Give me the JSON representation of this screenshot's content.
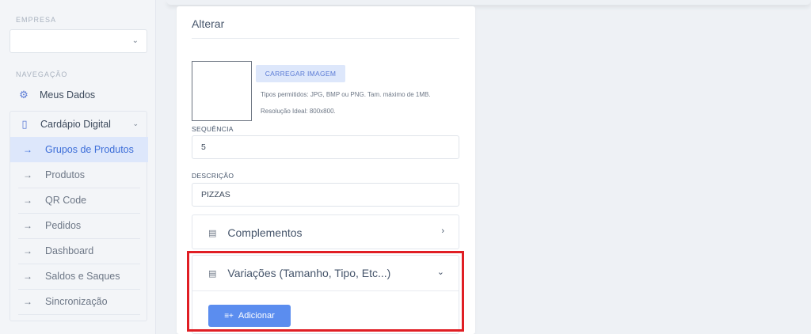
{
  "sidebar": {
    "empresa_label": "EMPRESA",
    "empresa_value": "",
    "navegacao_label": "NAVEGAÇÃO",
    "meus_dados": "Meus Dados",
    "cardapio": "Cardápio Digital",
    "items": [
      {
        "label": "Grupos de Produtos",
        "active": true
      },
      {
        "label": "Produtos"
      },
      {
        "label": "QR Code"
      },
      {
        "label": "Pedidos"
      },
      {
        "label": "Dashboard"
      },
      {
        "label": "Saldos e Saques"
      },
      {
        "label": "Sincronização"
      }
    ]
  },
  "form": {
    "title": "Alterar",
    "load_image": "CARREGAR IMAGEM",
    "hint_types": "Tipos permitidos: JPG, BMP ou PNG. Tam. máximo de 1MB.",
    "hint_resolution": "Resolução Ideal: 800x800.",
    "sequencia_label": "SEQUÊNCIA",
    "sequencia_value": "5",
    "descricao_label": "DESCRIÇÃO",
    "descricao_value": "PIZZAS"
  },
  "accordions": {
    "complementos": "Complementos",
    "variacoes": "Variações (Tamanho, Tipo, Etc...)",
    "add_button": "Adicionar"
  },
  "colors": {
    "accent": "#5b8def",
    "highlight": "#e01e24"
  }
}
